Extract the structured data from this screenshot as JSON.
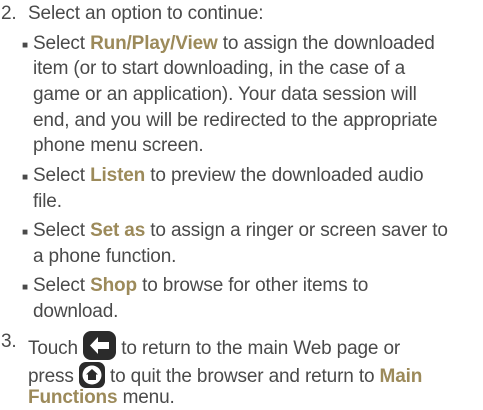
{
  "steps": [
    {
      "number": "2.",
      "text": "Select an option to continue:"
    },
    {
      "number": "3."
    }
  ],
  "bullets": [
    {
      "prefix": "Select",
      "term": "Run/Play/View",
      "line1_rest": "to assign the downloaded",
      "line2": "item (or to start downloading, in the case of a",
      "line3": "game or an application). Your data session will",
      "line4": "end, and you will be redirected to the appropriate",
      "line5": "phone menu screen."
    },
    {
      "prefix": "Select",
      "term": "Listen",
      "line1_rest": "to preview the downloaded audio",
      "line2": "file."
    },
    {
      "prefix": "Select",
      "term": "Set as",
      "line1_rest": "to assign a ringer or screen saver to",
      "line2": "a phone function."
    },
    {
      "prefix": "Select",
      "term": "Shop",
      "line1_rest": "to browse for other items to",
      "line2": "download."
    }
  ],
  "step3": {
    "part1": "Touch",
    "part2": "to return to the main Web page or",
    "part3": "press",
    "part4": "to quit the browser and return to",
    "term_main": "Main",
    "term_functions": "Functions",
    "part5": "menu."
  },
  "icons": {
    "back": "back-arrow-icon",
    "home": "home-icon"
  },
  "colors": {
    "text": "#4a4a4a",
    "term": "#9c8a5a",
    "icon_bg": "#2b2b2b"
  }
}
